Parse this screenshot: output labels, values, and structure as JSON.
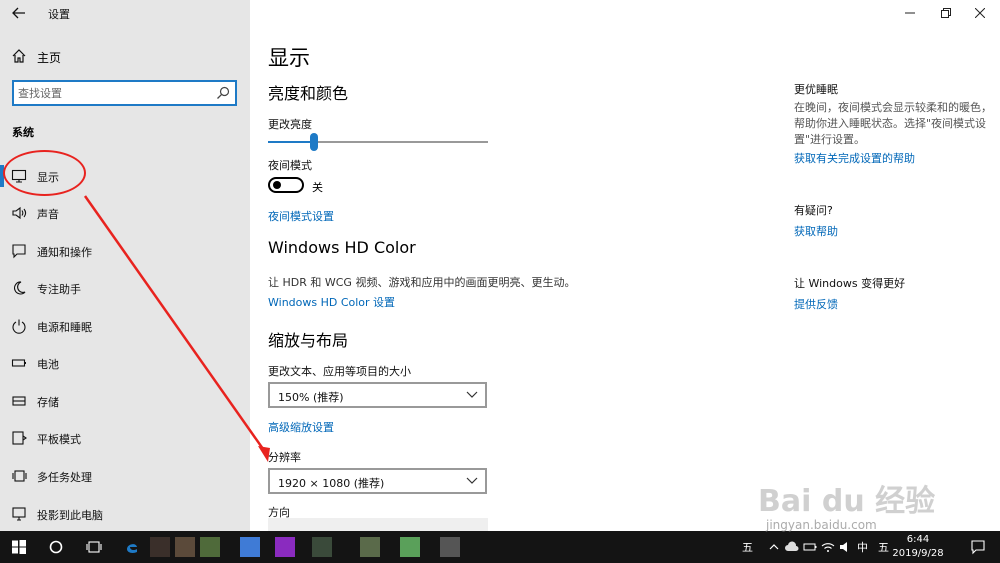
{
  "window": {
    "title": "设置",
    "back_icon": "back-arrow-icon",
    "controls": [
      "minimize-icon",
      "restore-icon",
      "close-icon"
    ]
  },
  "sidebar": {
    "home_label": "主页",
    "search_placeholder": "查找设置",
    "section_title": "系统",
    "items": [
      {
        "label": "显示",
        "icon": "monitor-icon",
        "active": true
      },
      {
        "label": "声音",
        "icon": "speaker-icon"
      },
      {
        "label": "通知和操作",
        "icon": "notification-icon"
      },
      {
        "label": "专注助手",
        "icon": "moon-icon"
      },
      {
        "label": "电源和睡眠",
        "icon": "power-icon"
      },
      {
        "label": "电池",
        "icon": "battery-icon"
      },
      {
        "label": "存储",
        "icon": "storage-icon"
      },
      {
        "label": "平板模式",
        "icon": "tablet-icon"
      },
      {
        "label": "多任务处理",
        "icon": "multitask-icon"
      },
      {
        "label": "投影到此电脑",
        "icon": "project-icon"
      }
    ]
  },
  "main": {
    "title": "显示",
    "brightness_section": "亮度和颜色",
    "brightness_label": "更改亮度",
    "brightness_value": 0.21,
    "night_light_label": "夜间模式",
    "night_light_state": "关",
    "night_light_settings_link": "夜间模式设置",
    "hdr_title": "Windows HD Color",
    "hdr_desc": "让 HDR 和 WCG 视频、游戏和应用中的画面更明亮、更生动。",
    "hdr_link": "Windows HD Color 设置",
    "scale_section": "缩放与布局",
    "scale_label": "更改文本、应用等项目的大小",
    "scale_value": "150% (推荐)",
    "advanced_scale_link": "高级缩放设置",
    "resolution_label": "分辨率",
    "resolution_value": "1920 × 1080 (推荐)",
    "orientation_label": "方向"
  },
  "right_pane": {
    "sleep_title": "更优睡眠",
    "sleep_desc": "在晚间，夜间模式会显示较柔和的暖色，帮助你进入睡眠状态。选择\"夜间模式设置\"进行设置。",
    "sleep_link": "获取有关完成设置的帮助",
    "help_title": "有疑问?",
    "help_link": "获取帮助",
    "feedback_title": "让 Windows 变得更好",
    "feedback_link": "提供反馈"
  },
  "taskbar": {
    "ime_label_1": "五",
    "ime_label_2": "中",
    "ime_label_3": "五",
    "clock_time": "6:44",
    "clock_date": "2019/9/28",
    "icons": [
      "start-icon",
      "cortana-icon",
      "taskview-icon",
      "edge-icon"
    ]
  },
  "watermark": {
    "brand": "Bai du 经验",
    "url": "jingyan.baidu.com"
  },
  "colors": {
    "accent": "#1e7ac6",
    "link": "#0067b8",
    "annotation": "#e8231f",
    "sidebar_bg": "#e6e6e6",
    "taskbar_bg": "#141414"
  }
}
